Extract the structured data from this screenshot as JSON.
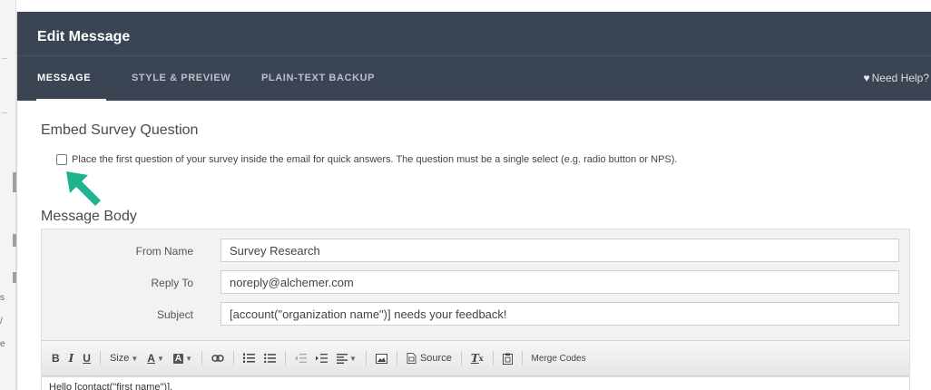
{
  "modal": {
    "title": "Edit Message",
    "tabs": [
      {
        "label": "MESSAGE",
        "active": true
      },
      {
        "label": "STYLE & PREVIEW",
        "active": false
      },
      {
        "label": "PLAIN-TEXT BACKUP",
        "active": false
      }
    ],
    "need_help": "Need Help?"
  },
  "embed": {
    "title": "Embed Survey Question",
    "checkbox_label": "Place the first question of your survey inside the email for quick answers. The question must be a single select (e.g. radio button or NPS).",
    "checked": false
  },
  "message_body": {
    "title": "Message Body",
    "fields": [
      {
        "label": "From Name",
        "value": "Survey Research"
      },
      {
        "label": "Reply To",
        "value": "noreply@alchemer.com"
      },
      {
        "label": "Subject",
        "value": "[account(\"organization name\")] needs your feedback!"
      }
    ],
    "toolbar": {
      "bold": "B",
      "italic": "I",
      "underline": "U",
      "size": "Size",
      "text_color": "A",
      "bg_color": "A",
      "source": "Source",
      "remove_format": "T",
      "merge_codes": "Merge Codes"
    },
    "editor_text": "Hello [contact(\"first name\")],"
  },
  "colors": {
    "header_bg": "#3b4452",
    "arrow": "#1db38f"
  },
  "gutter": {
    "edge_glyphs": [
      "s",
      "/",
      "e"
    ]
  }
}
